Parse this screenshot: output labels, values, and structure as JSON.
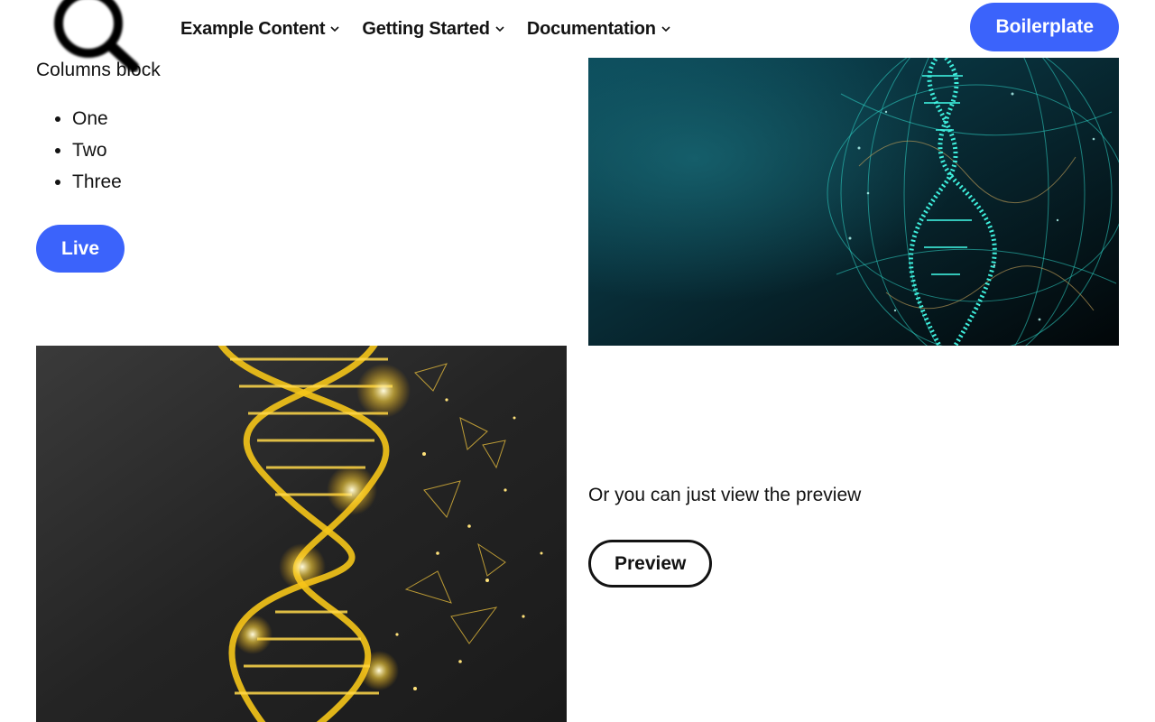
{
  "header": {
    "logo_icon": "search-icon",
    "nav": [
      {
        "label": "Example Content",
        "icon": "chevron-down-icon"
      },
      {
        "label": "Getting Started",
        "icon": "chevron-down-icon"
      },
      {
        "label": "Documentation",
        "icon": "chevron-down-icon"
      }
    ],
    "cta_label": "Boilerplate"
  },
  "columns": {
    "title": "Columns block",
    "list": [
      "One",
      "Two",
      "Three"
    ],
    "live_label": "Live",
    "preview_text": "Or you can just view the preview",
    "preview_label": "Preview"
  },
  "colors": {
    "accent": "#3b63fb",
    "text": "#131313",
    "background": "#ffffff"
  }
}
